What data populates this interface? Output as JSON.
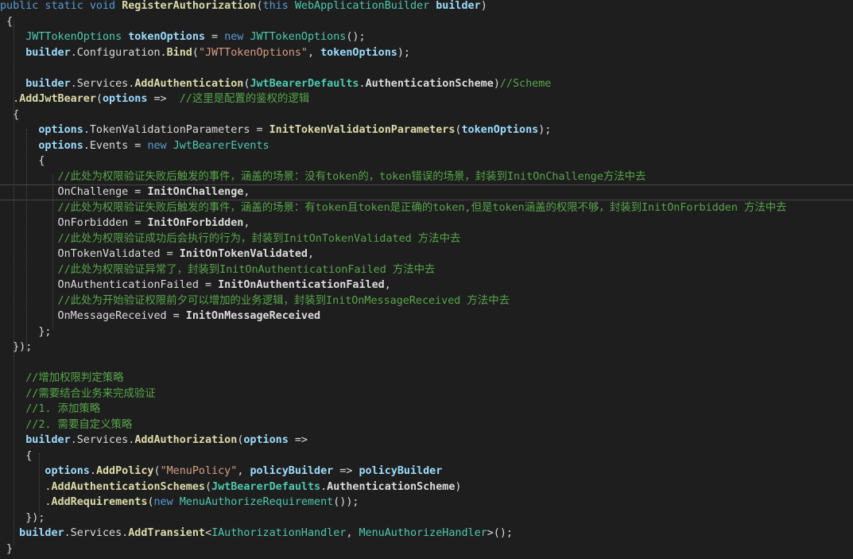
{
  "theme": {
    "background": "#1e1e1e",
    "text": "#dcdcdc",
    "keyword": "#569cd6",
    "type": "#4ec9b0",
    "method": "#dcdcaa",
    "parameter": "#9cdcfe",
    "string": "#d69d85",
    "comment": "#57a64a"
  },
  "code_lines": [
    [
      [
        "kw",
        "public static void "
      ],
      [
        "fn b",
        "RegisterAuthorization"
      ],
      [
        "pl",
        "("
      ],
      [
        "kw",
        "this "
      ],
      [
        "ty",
        "WebApplicationBuilder "
      ],
      [
        "pm b",
        "builder"
      ],
      [
        "pl",
        ")"
      ]
    ],
    [
      [
        "pl",
        " {"
      ]
    ],
    [
      [
        "ty",
        "    JWTTokenOptions "
      ],
      [
        "pm b",
        "tokenOptions"
      ],
      [
        "pl",
        " = "
      ],
      [
        "kw",
        "new "
      ],
      [
        "ty",
        "JWTTokenOptions"
      ],
      [
        "pl",
        "();"
      ]
    ],
    [
      [
        "pm b",
        "    builder"
      ],
      [
        "pl",
        ".Configuration."
      ],
      [
        "fn b",
        "Bind"
      ],
      [
        "pl",
        "("
      ],
      [
        "st",
        "\"JWTTokenOptions\""
      ],
      [
        "pl",
        ", "
      ],
      [
        "pm b",
        "tokenOptions"
      ],
      [
        "pl",
        ");"
      ]
    ],
    [
      [
        "pl",
        ""
      ]
    ],
    [
      [
        "pm b",
        "    builder"
      ],
      [
        "pl",
        ".Services."
      ],
      [
        "fn b",
        "AddAuthentication"
      ],
      [
        "pl",
        "("
      ],
      [
        "ty b",
        "JwtBearerDefaults"
      ],
      [
        "pl",
        "."
      ],
      [
        "pl b",
        "AuthenticationScheme"
      ],
      [
        "pl",
        ")"
      ],
      [
        "cm",
        "//Scheme"
      ]
    ],
    [
      [
        "pl",
        "  ."
      ],
      [
        "fn b",
        "AddJwtBearer"
      ],
      [
        "pl",
        "("
      ],
      [
        "pm b",
        "options"
      ],
      [
        "pl",
        " =>  "
      ],
      [
        "cm",
        "//这里是配置的鉴权的逻辑"
      ]
    ],
    [
      [
        "pl",
        "  {"
      ]
    ],
    [
      [
        "pm b",
        "      options"
      ],
      [
        "pl",
        ".TokenValidationParameters = "
      ],
      [
        "fn b",
        "InitTokenValidationParameters"
      ],
      [
        "pl",
        "("
      ],
      [
        "pm b",
        "tokenOptions"
      ],
      [
        "pl",
        ");"
      ]
    ],
    [
      [
        "pm b",
        "      options"
      ],
      [
        "pl",
        ".Events = "
      ],
      [
        "kw",
        "new "
      ],
      [
        "ty",
        "JwtBearerEvents"
      ]
    ],
    [
      [
        "pl",
        "      {"
      ]
    ],
    [
      [
        "cm",
        "         //此处为权限验证失败后触发的事件，涵盖的场景：没有token的，token错误的场景，封装到InitOnChallenge方法中去"
      ]
    ],
    [
      [
        "pl",
        "         OnChallenge = "
      ],
      [
        "pl b",
        "InitOnChallenge"
      ],
      [
        "pl",
        ","
      ]
    ],
    [
      [
        "cm",
        "         //此处为权限验证失败后触发的事件，涵盖的场景：有token且token是正确的token,但是token涵盖的权限不够，封装到InitOnForbidden 方法中去"
      ]
    ],
    [
      [
        "pl",
        "         OnForbidden = "
      ],
      [
        "pl b",
        "InitOnForbidden"
      ],
      [
        "pl",
        ","
      ]
    ],
    [
      [
        "cm",
        "         //此处为权限验证成功后会执行的行为，封装到InitOnTokenValidated 方法中去"
      ]
    ],
    [
      [
        "pl",
        "         OnTokenValidated = "
      ],
      [
        "pl b",
        "InitOnTokenValidated"
      ],
      [
        "pl",
        ","
      ]
    ],
    [
      [
        "cm",
        "         //此处为权限验证异常了，封装到InitOnAuthenticationFailed 方法中去"
      ]
    ],
    [
      [
        "pl",
        "         OnAuthenticationFailed = "
      ],
      [
        "pl b",
        "InitOnAuthenticationFailed"
      ],
      [
        "pl",
        ","
      ]
    ],
    [
      [
        "cm",
        "         //此处为开始验证权限前夕可以增加的业务逻辑，封装到InitOnMessageReceived 方法中去"
      ]
    ],
    [
      [
        "pl",
        "         OnMessageReceived = "
      ],
      [
        "pl b",
        "InitOnMessageReceived"
      ]
    ],
    [
      [
        "pl",
        "      };"
      ]
    ],
    [
      [
        "pl",
        "  });"
      ]
    ],
    [
      [
        "pl",
        ""
      ]
    ],
    [
      [
        "cm",
        "    //增加权限判定策略"
      ]
    ],
    [
      [
        "cm",
        "    //需要结合业务来完成验证"
      ]
    ],
    [
      [
        "cm",
        "    //1. 添加策略"
      ]
    ],
    [
      [
        "cm",
        "    //2. 需要自定义策略"
      ]
    ],
    [
      [
        "pm b",
        "    builder"
      ],
      [
        "pl",
        ".Services."
      ],
      [
        "fn b",
        "AddAuthorization"
      ],
      [
        "pl",
        "("
      ],
      [
        "pm b",
        "options"
      ],
      [
        "pl",
        " =>"
      ]
    ],
    [
      [
        "pl",
        "    {"
      ]
    ],
    [
      [
        "pm b",
        "       options"
      ],
      [
        "pl",
        "."
      ],
      [
        "fn b",
        "AddPolicy"
      ],
      [
        "pl",
        "("
      ],
      [
        "st",
        "\"MenuPolicy\""
      ],
      [
        "pl",
        ", "
      ],
      [
        "pm b",
        "policyBuilder"
      ],
      [
        "pl",
        " => "
      ],
      [
        "pm b",
        "policyBuilder"
      ]
    ],
    [
      [
        "pl",
        "       ."
      ],
      [
        "fn b",
        "AddAuthenticationSchemes"
      ],
      [
        "pl",
        "("
      ],
      [
        "ty b",
        "JwtBearerDefaults"
      ],
      [
        "pl",
        "."
      ],
      [
        "pl b",
        "AuthenticationScheme"
      ],
      [
        "pl",
        ")"
      ]
    ],
    [
      [
        "pl",
        "       ."
      ],
      [
        "fn b",
        "AddRequirements"
      ],
      [
        "pl",
        "("
      ],
      [
        "kw",
        "new "
      ],
      [
        "ty",
        "MenuAuthorizeRequirement"
      ],
      [
        "pl",
        "());"
      ]
    ],
    [
      [
        "pl",
        "    });"
      ]
    ],
    [
      [
        "pm b",
        "   builder"
      ],
      [
        "pl",
        ".Services."
      ],
      [
        "fn b",
        "AddTransient"
      ],
      [
        "pl",
        "<"
      ],
      [
        "ty",
        "IAuthorizationHandler"
      ],
      [
        "pl",
        ", "
      ],
      [
        "ty",
        "MenuAuthorizeHandler"
      ],
      [
        "pl",
        ">();"
      ]
    ],
    [
      [
        "pl",
        " }"
      ]
    ]
  ]
}
